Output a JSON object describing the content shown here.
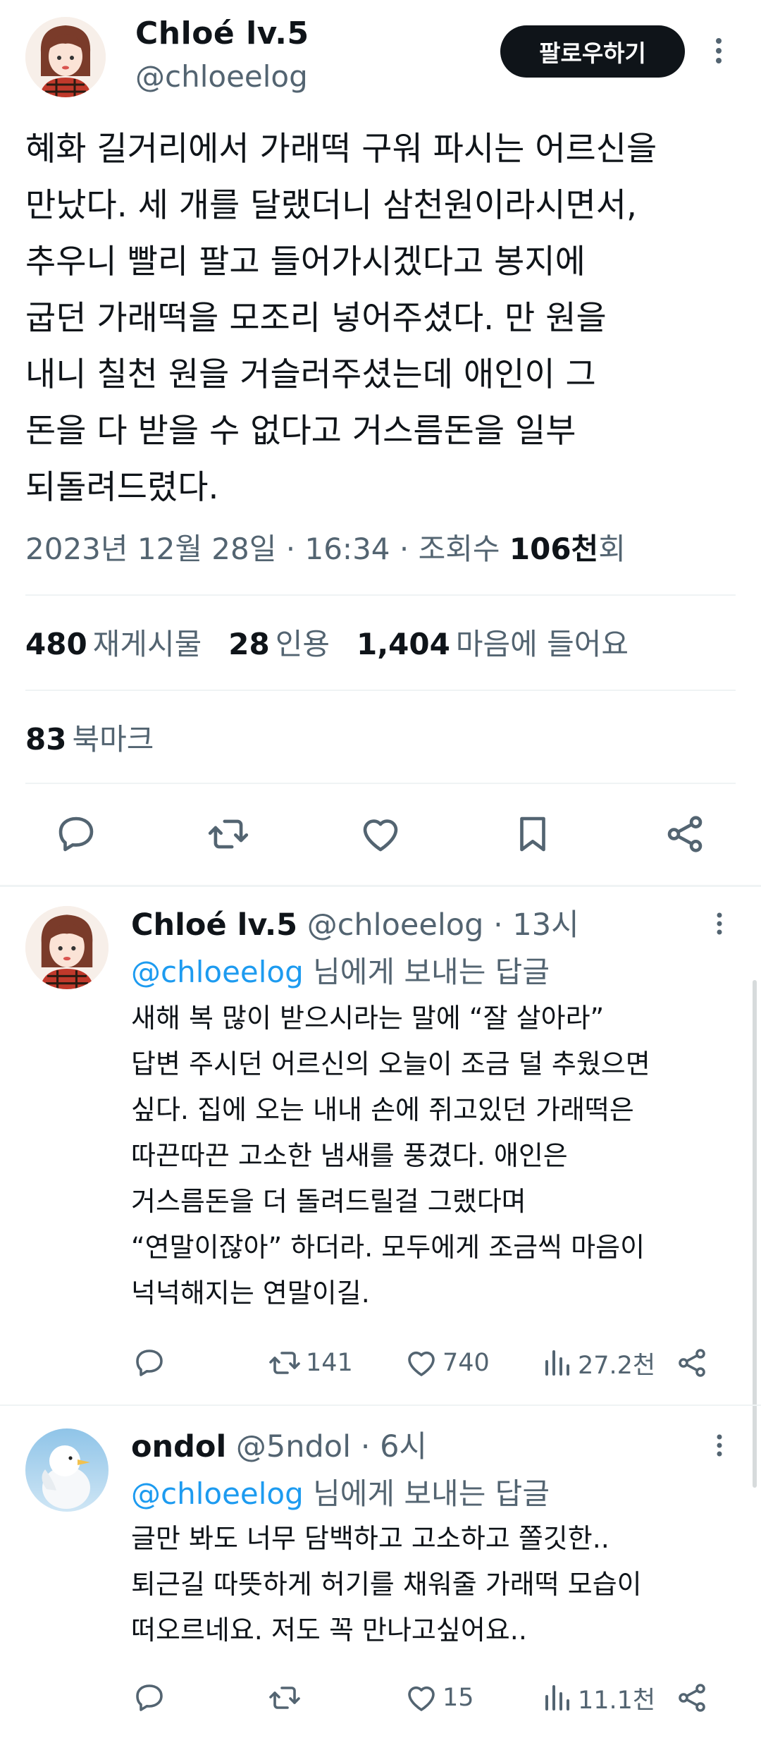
{
  "tweet": {
    "author_name": "Chloé lv.5",
    "author_handle": "@chloeelog",
    "follow_label": "팔로우하기",
    "lines": [
      "혜화 길거리에서 가래떡 구워 파시는 어르신을",
      "만났다. 세 개를 달랬더니 삼천원이라시면서,",
      "추우니 빨리 팔고 들어가시겠다고 봉지에",
      "굽던 가래떡을 모조리 넣어주셨다. 만 원을",
      "내니 칠천 원을 거슬러주셨는데 애인이 그",
      "돈을 다 받을 수 없다고 거스름돈을 일부",
      "되돌려드렸다."
    ],
    "date": "2023년 12월 28일",
    "time": "16:34",
    "views_label": "조회수",
    "views_value": "106천",
    "views_suffix": "회",
    "retweets_count": "480",
    "retweets_label": "재게시물",
    "quotes_count": "28",
    "quotes_label": "인용",
    "likes_count": "1,404",
    "likes_label": "마음에 들어요",
    "bookmarks_count": "83",
    "bookmarks_label": "북마크"
  },
  "replies": [
    {
      "name": "Chloé lv.5",
      "handle": "@chloeelog",
      "time": "13시",
      "reply_to": "@chloeelog",
      "reply_suffix": "님에게 보내는 답글",
      "lines": [
        "새해 복 많이 받으시라는 말에 “잘 살아라”",
        "답변 주시던 어르신의 오늘이 조금 덜 추웠으면",
        "싶다. 집에 오는 내내 손에 쥐고있던 가래떡은",
        "따끈따끈 고소한 냄새를 풍겼다. 애인은",
        "거스름돈을 더 돌려드릴걸 그랬다며",
        "“연말이잖아” 하더라. 모두에게 조금씩 마음이",
        "넉넉해지는 연말이길."
      ],
      "retweets": "141",
      "likes": "740",
      "views": "27.2천"
    },
    {
      "name": "ondol",
      "handle": "@5ndol",
      "time": "6시",
      "reply_to": "@chloeelog",
      "reply_suffix": "님에게 보내는 답글",
      "lines": [
        "글만 봐도 너무 담백하고 고소하고 쫄깃한..",
        "퇴근길 따뜻하게 허기를 채워줄 가래떡 모습이",
        "떠오르네요. 저도 꼭 만나고싶어요.."
      ],
      "retweets": "",
      "likes": "15",
      "views": "11.1천"
    }
  ],
  "separator": "·",
  "colors": {
    "accent": "#1d9bf0",
    "muted": "#536471",
    "text": "#0f1419",
    "divider": "#eff3f4"
  }
}
